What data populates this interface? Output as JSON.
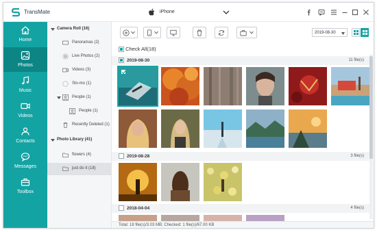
{
  "app": {
    "title": "TransMate",
    "device": "iPhone"
  },
  "sidebar": {
    "items": [
      {
        "label": "Home",
        "icon": "home-icon",
        "active": false
      },
      {
        "label": "Photos",
        "icon": "photos-icon",
        "active": true
      },
      {
        "label": "Music",
        "icon": "music-icon",
        "active": false
      },
      {
        "label": "Videos",
        "icon": "video-icon",
        "active": false
      },
      {
        "label": "Contacts",
        "icon": "contacts-icon",
        "active": false
      },
      {
        "label": "Messages",
        "icon": "messages-icon",
        "active": false
      },
      {
        "label": "Toolbox",
        "icon": "toolbox-icon",
        "active": false
      }
    ]
  },
  "tree": {
    "camera_roll": "Camera Roll (16)",
    "panoramas": "Panoramas (2)",
    "live_photos": "Live Photos (2)",
    "videos": "Videos (3)",
    "slomo": "Slo-mo (1)",
    "people": "People (1)",
    "people_sub": "People (1)",
    "recently_deleted": "Recently Deleted (1)",
    "photo_library": "Photo Library (41)",
    "flowers": "flowers (4)",
    "just_do_it": "just do it (18)"
  },
  "toolbar": {
    "date_value": "2019-08-30"
  },
  "content": {
    "check_all": "Check All(18)",
    "groups": [
      {
        "date": "2019-08-30",
        "count": "11 file(s)"
      },
      {
        "date": "2019-08-28",
        "count": "3 file(s)"
      },
      {
        "date": "2018-04-04",
        "count": "4 file(s)"
      }
    ]
  },
  "status": {
    "text": "Total: 18 file(s)/3.03 MB; Checked: 1 file(s)/67.00 KB"
  },
  "colors": {
    "accent": "#14a3a3",
    "accent_dark": "#0d8585"
  }
}
